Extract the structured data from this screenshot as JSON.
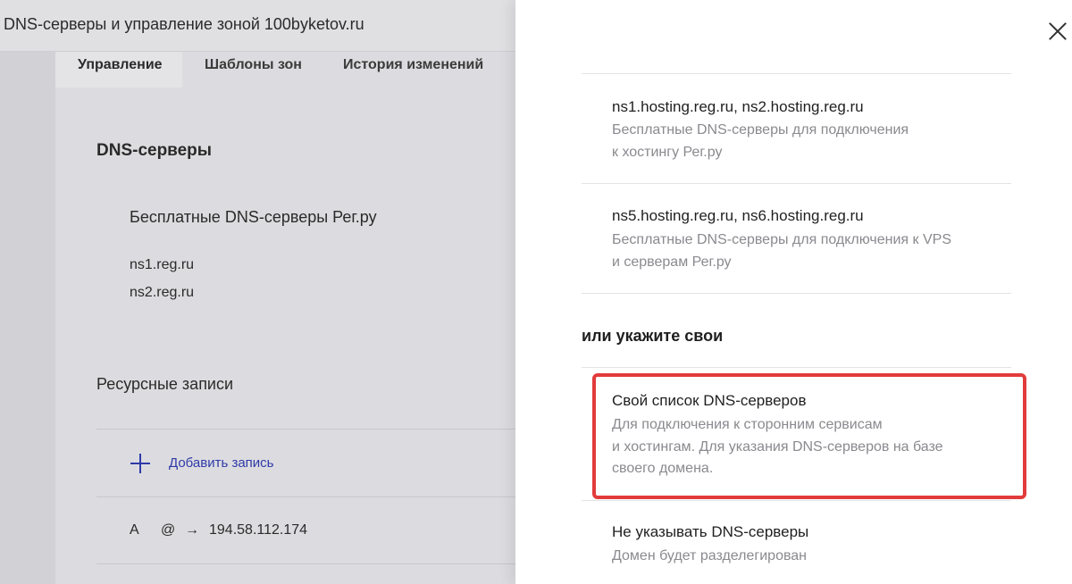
{
  "background": {
    "title": "DNS-серверы и управление зоной 100byketov.ru",
    "tabs": [
      {
        "label": "Управление",
        "active": true
      },
      {
        "label": "Шаблоны зон",
        "active": false
      },
      {
        "label": "История изменений",
        "active": false
      }
    ],
    "dns_section": {
      "heading": "DNS-серверы",
      "subheading": "Бесплатные DNS-серверы Рег.ру",
      "servers": [
        "ns1.reg.ru",
        "ns2.reg.ru"
      ]
    },
    "records_section": {
      "heading": "Ресурсные записи",
      "add_label": "Добавить запись",
      "record": {
        "type": "A",
        "host": "@",
        "arrow": "→",
        "value": "194.58.112.174"
      }
    }
  },
  "panel": {
    "close_icon": "close-icon",
    "options": [
      {
        "title": "ns1.hosting.reg.ru, ns2.hosting.reg.ru",
        "desc": [
          "Бесплатные DNS-серверы для подключения",
          "к хостингу Рег.ру"
        ]
      },
      {
        "title": "ns5.hosting.reg.ru, ns6.hosting.reg.ru",
        "desc": [
          "Бесплатные DNS-серверы для подключения к VPS",
          "и серверам Рег.ру"
        ]
      }
    ],
    "custom_heading": "или укажите свои",
    "custom_option": {
      "title": "Свой список DNS-серверов",
      "desc": [
        "Для подключения к сторонним сервисам",
        "и хостингам. Для указания DNS-серверов на базе",
        "своего домена."
      ]
    },
    "none_option": {
      "title": "Не указывать DNS-серверы",
      "desc": [
        "Домен будет разделегирован"
      ]
    },
    "highlight_color": "#e23b3b"
  }
}
